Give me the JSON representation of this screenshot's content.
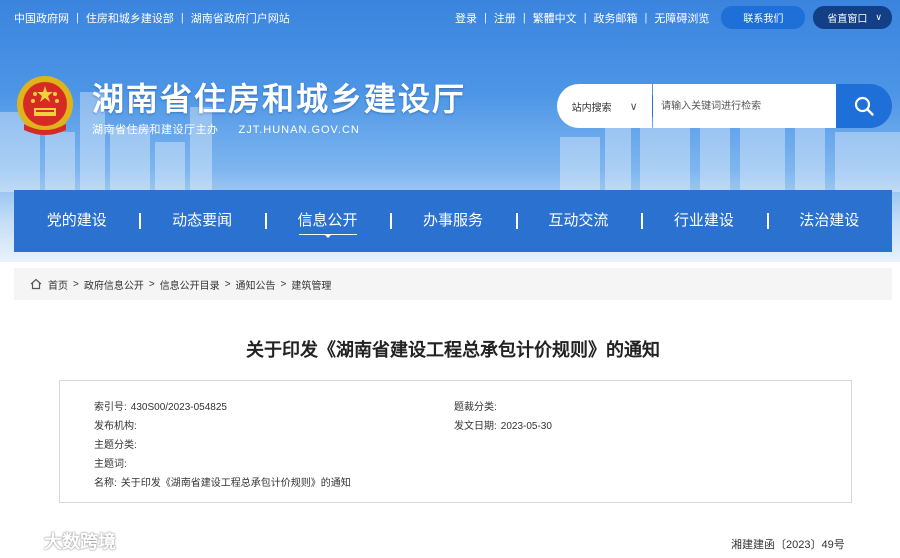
{
  "topbar": {
    "left_links": [
      "中国政府网",
      "住房和城乡建设部",
      "湖南省政府门户网站"
    ],
    "right_links": [
      "登录",
      "注册",
      "繁體中文",
      "政务邮箱",
      "无障碍浏览"
    ],
    "contact_label": "联系我们",
    "window_label": "省直窗口"
  },
  "header": {
    "title": "湖南省住房和城乡建设厅",
    "sponsor": "湖南省住房和建设厅主办",
    "domain": "ZJT.HUNAN.GOV.CN",
    "colors": {
      "brand_blue": "#2b71cf",
      "pill_blue": "#1f6fd8",
      "pill_dark": "#123f86"
    }
  },
  "search": {
    "scope_label": "站内搜索",
    "placeholder": "请输入关键词进行检索"
  },
  "nav": {
    "items": [
      "党的建设",
      "动态要闻",
      "信息公开",
      "办事服务",
      "互动交流",
      "行业建设",
      "法治建设"
    ],
    "active": "信息公开"
  },
  "breadcrumb": [
    "首页",
    "政府信息公开",
    "信息公开目录",
    "通知公告",
    "建筑管理"
  ],
  "document": {
    "title": "关于印发《湖南省建设工程总承包计价规则》的通知",
    "meta": {
      "index_label": "索引号:",
      "index_value": "430S00/2023-054825",
      "category_label": "题裁分类:",
      "category_value": "",
      "publisher_label": "发布机构:",
      "publisher_value": "",
      "date_label": "发文日期:",
      "date_value": "2023-05-30",
      "topic_label": "主题分类:",
      "topic_value": "",
      "keywords_label": "主题词:",
      "keywords_value": "",
      "name_label": "名称:",
      "name_value": "关于印发《湖南省建设工程总承包计价规则》的通知"
    },
    "doc_number": "湘建建函〔2023〕49号"
  },
  "watermark": {
    "text": "大数跨境"
  }
}
